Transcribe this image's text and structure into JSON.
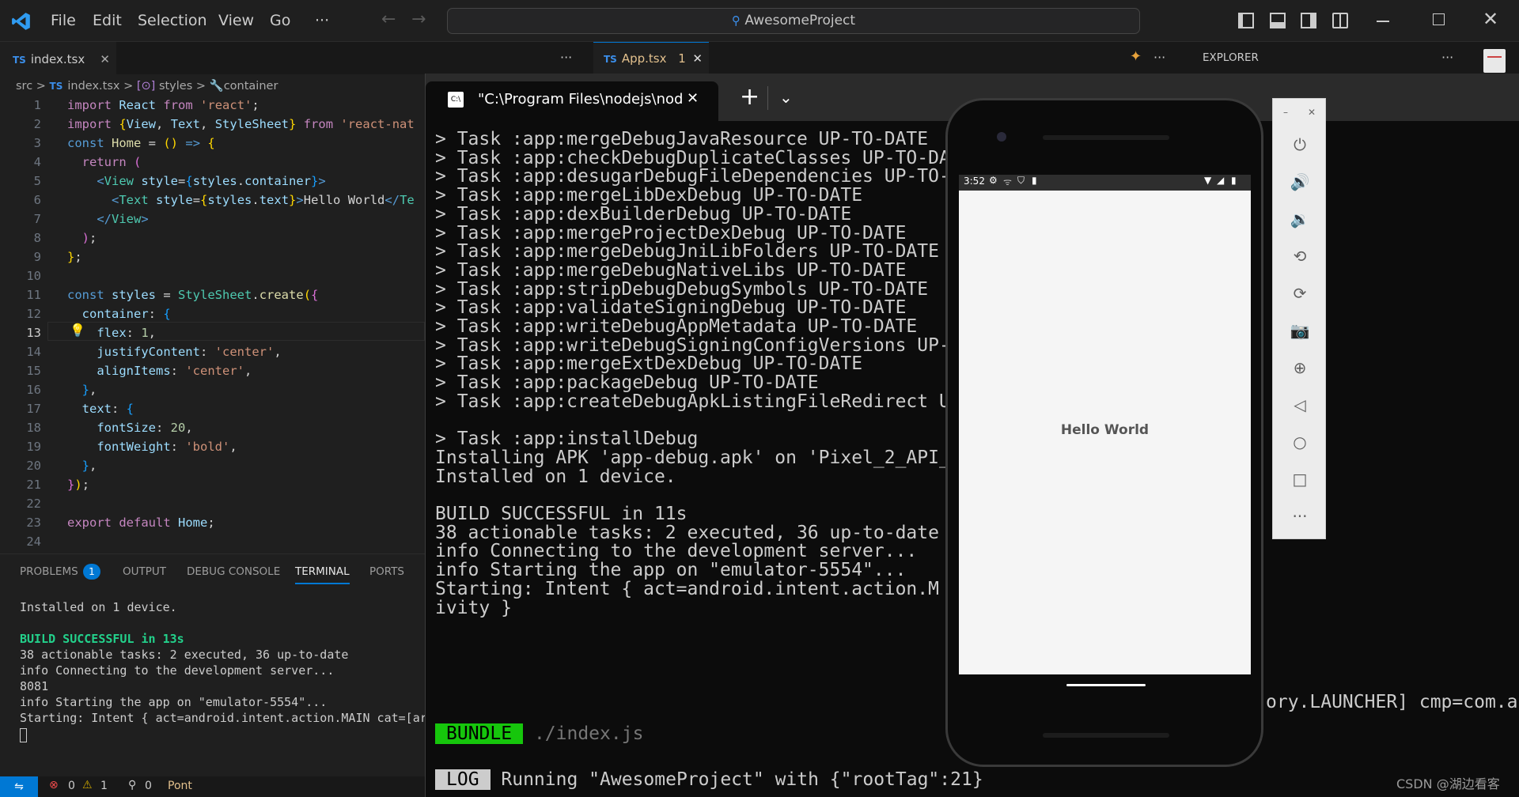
{
  "titlebar": {
    "menu": [
      "File",
      "Edit",
      "Selection",
      "View",
      "Go",
      "···"
    ],
    "search": "AwesomeProject"
  },
  "tabs": {
    "left_tab": {
      "prefix": "TS",
      "label": "index.tsx"
    },
    "mid_tab": {
      "prefix": "TS",
      "label": "App.tsx",
      "badge": "1"
    },
    "explorer": "EXPLORER"
  },
  "breadcrumb": {
    "src": "src",
    "ts": "TS",
    "file": "index.tsx",
    "styles": "styles",
    "container": "container"
  },
  "editor": {
    "line_numbers": [
      "1",
      "2",
      "3",
      "4",
      "5",
      "6",
      "7",
      "8",
      "9",
      "10",
      "11",
      "12",
      "13",
      "14",
      "15",
      "16",
      "17",
      "18",
      "19",
      "20",
      "21",
      "22",
      "23",
      "24"
    ]
  },
  "panel": {
    "tabs": {
      "problems": "PROBLEMS",
      "problems_count": "1",
      "output": "OUTPUT",
      "debug": "DEBUG CONSOLE",
      "terminal": "TERMINAL",
      "ports": "PORTS"
    },
    "lines": [
      "Installed on 1 device.",
      "",
      "BUILD SUCCESSFUL in 13s",
      "38 actionable tasks: 2 executed, 36 up-to-date",
      "info Connecting to the development server...",
      "8081",
      "info Starting the app on \"emulator-5554\"...",
      "Starting: Intent { act=android.intent.action.MAIN cat=[ar"
    ]
  },
  "status": {
    "errors": "0",
    "warnings": "1",
    "ports": "0",
    "pont": "Pont"
  },
  "terminal_window": {
    "tab_title": "\"C:\\Program Files\\nodejs\\nod",
    "lines": [
      "> Task :app:mergeDebugJavaResource UP-TO-DATE",
      "> Task :app:checkDebugDuplicateClasses UP-TO-DA",
      "> Task :app:desugarDebugFileDependencies UP-TO-",
      "> Task :app:mergeLibDexDebug UP-TO-DATE",
      "> Task :app:dexBuilderDebug UP-TO-DATE",
      "> Task :app:mergeProjectDexDebug UP-TO-DATE",
      "> Task :app:mergeDebugJniLibFolders UP-TO-DATE",
      "> Task :app:mergeDebugNativeLibs UP-TO-DATE",
      "> Task :app:stripDebugDebugSymbols UP-TO-DATE",
      "> Task :app:validateSigningDebug UP-TO-DATE",
      "> Task :app:writeDebugAppMetadata UP-TO-DATE",
      "> Task :app:writeDebugSigningConfigVersions UP-",
      "> Task :app:mergeExtDexDebug UP-TO-DATE",
      "> Task :app:packageDebug UP-TO-DATE",
      "> Task :app:createDebugApkListingFileRedirect U",
      "",
      "> Task :app:installDebug",
      "Installing APK 'app-debug.apk' on 'Pixel_2_API_",
      "Installed on 1 device.",
      "",
      "BUILD SUCCESSFUL in 11s",
      "38 actionable tasks: 2 executed, 36 up-to-date",
      "info Connecting to the development server...",
      "info Starting the app on \"emulator-5554\"...",
      "Starting: Intent { act=android.intent.action.M",
      "ivity }"
    ],
    "line_tail": "ory.LAUNCHER] cmp=com.a",
    "bundle_tag": "BUNDLE",
    "bundle_text": " ./index.js",
    "log_tag": "LOG",
    "log_text": " Running \"AwesomeProject\" with {\"rootTag\":21}"
  },
  "phone": {
    "time": "3:52",
    "hello": "Hello World"
  },
  "watermark": "CSDN @湖边看客"
}
